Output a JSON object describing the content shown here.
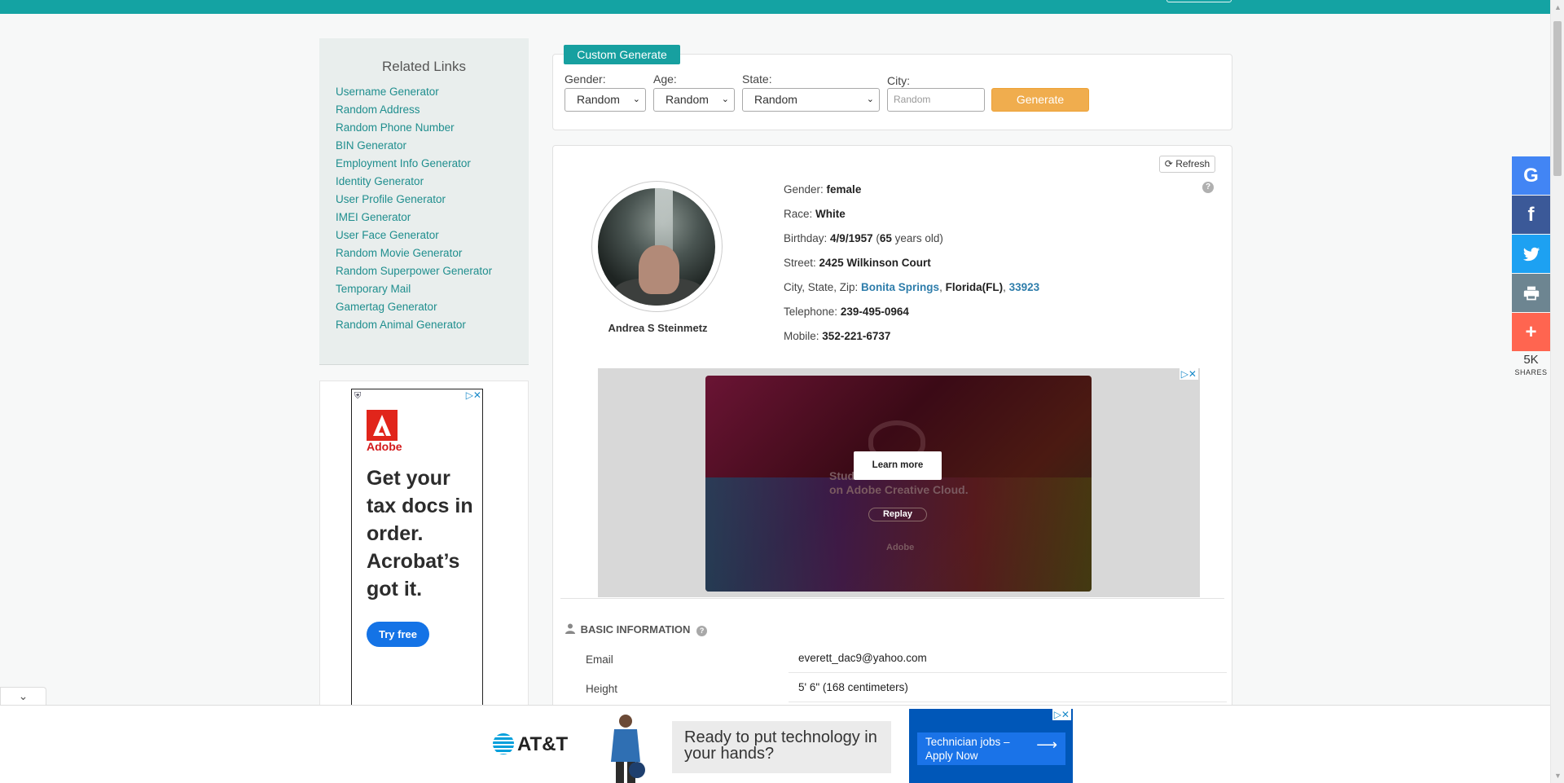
{
  "related": {
    "title": "Related Links",
    "links": [
      "Username Generator",
      "Random Address",
      "Random Phone Number",
      "BIN Generator",
      "Employment Info Generator",
      "Identity Generator",
      "User Profile Generator",
      "IMEI Generator",
      "User Face Generator",
      "Random Movie Generator",
      "Random Superpower Generator",
      "Temporary Mail",
      "Gamertag Generator",
      "Random Animal Generator"
    ]
  },
  "side_ad": {
    "brand": "Adobe",
    "headline": "Get your tax docs in order. Acrobat’s got it.",
    "button": "Try free"
  },
  "custom": {
    "tab_label": "Custom Generate",
    "gender_label": "Gender:",
    "gender_value": "Random",
    "age_label": "Age:",
    "age_value": "Random",
    "state_label": "State:",
    "state_value": "Random",
    "city_label": "City:",
    "city_placeholder": "Random",
    "generate_label": "Generate"
  },
  "profile": {
    "refresh_label": "Refresh",
    "name": "Andrea S Steinmetz",
    "gender_label": "Gender:",
    "gender": "female",
    "race_label": "Race:",
    "race": "White",
    "birthday_label": "Birthday:",
    "birthday": "4/9/1957",
    "age": "65",
    "age_suffix": "years old)",
    "street_label": "Street:",
    "street": "2425 Wilkinson Court",
    "csz_label": "City, State, Zip:",
    "city": "Bonita Springs",
    "state": "Florida(FL)",
    "zip": "33923",
    "telephone_label": "Telephone:",
    "telephone": "239-495-0964",
    "mobile_label": "Mobile:",
    "mobile": "352-221-6737"
  },
  "mid_ad": {
    "learn_more": "Learn more",
    "replay": "Replay",
    "line1": "Stud                     0%",
    "line2": "on Adobe Creative Cloud.",
    "logo_text": "Adobe"
  },
  "basic": {
    "heading": "BASIC INFORMATION",
    "rows": [
      {
        "label": "Email",
        "value": "everett_dac9@yahoo.com"
      },
      {
        "label": "Height",
        "value": "5' 6\" (168 centimeters)"
      }
    ]
  },
  "share": {
    "count": "5K",
    "label": "SHARES",
    "colors": {
      "google": "#4285f4",
      "facebook": "#3b5998",
      "twitter": "#1da1f2",
      "print": "#6d8591",
      "more": "#ff6550"
    }
  },
  "bottom_ad": {
    "brand": "AT&T",
    "message": "Ready to put technology in your hands?",
    "cta": "Technician jobs – Apply Now"
  }
}
